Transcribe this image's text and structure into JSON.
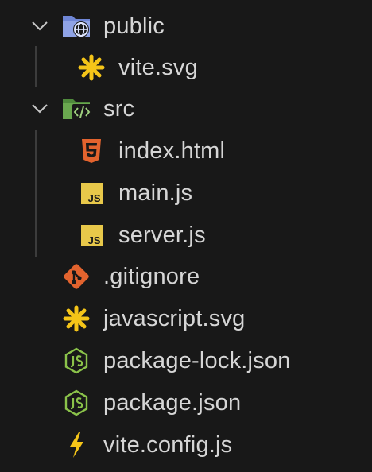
{
  "explorer": {
    "items": [
      {
        "label": "public",
        "kind": "folder-open",
        "icon": "public-folder-icon"
      },
      {
        "label": "vite.svg",
        "kind": "file",
        "icon": "svg-file-icon"
      },
      {
        "label": "src",
        "kind": "folder-open",
        "icon": "src-folder-icon"
      },
      {
        "label": "index.html",
        "kind": "file",
        "icon": "html-file-icon"
      },
      {
        "label": "main.js",
        "kind": "file",
        "icon": "js-file-icon"
      },
      {
        "label": "server.js",
        "kind": "file",
        "icon": "js-file-icon"
      },
      {
        "label": ".gitignore",
        "kind": "file",
        "icon": "git-file-icon"
      },
      {
        "label": "javascript.svg",
        "kind": "file",
        "icon": "svg-file-icon"
      },
      {
        "label": "package-lock.json",
        "kind": "file",
        "icon": "node-json-file-icon"
      },
      {
        "label": "package.json",
        "kind": "file",
        "icon": "node-json-file-icon"
      },
      {
        "label": "vite.config.js",
        "kind": "file",
        "icon": "vite-file-icon"
      }
    ],
    "js_badge_text": "JS"
  },
  "colors": {
    "background": "#181818",
    "text": "#d6d6d6",
    "svg_icon": "#f5c518",
    "html_icon": "#e2632e",
    "git_icon": "#e2632e",
    "js_icon": "#e8c84a",
    "node_icon": "#8bc34a",
    "vite_icon": "#f5c518",
    "folder_blue": "#6f86d6",
    "folder_green": "#6aa84f"
  }
}
